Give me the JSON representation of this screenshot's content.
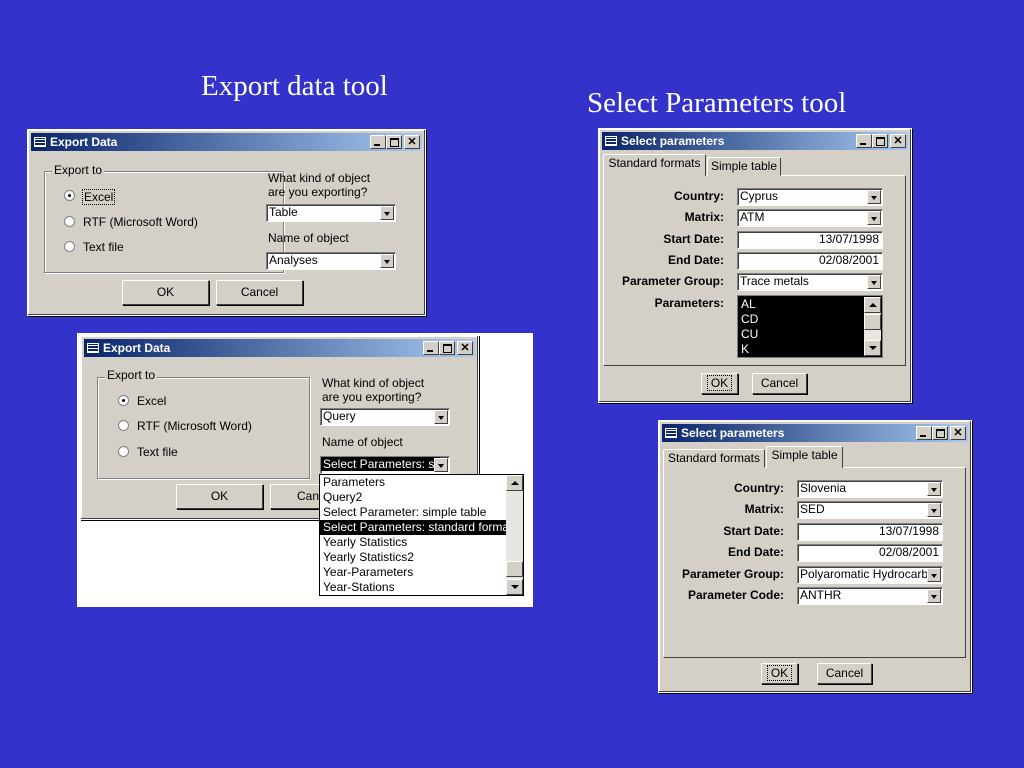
{
  "headings": {
    "export_tool": "Export data tool",
    "select_tool": "Select Parameters tool"
  },
  "export1": {
    "title": "Export Data",
    "group_label": "Export to",
    "options": [
      "Excel",
      "RTF (Microsoft Word)",
      "Text file"
    ],
    "selected_option": "Excel",
    "kind_label_1": "What kind of object",
    "kind_label_2": "are you exporting?",
    "kind_value": "Table",
    "name_label": "Name of object",
    "name_value": "Analyses",
    "ok": "OK",
    "cancel": "Cancel"
  },
  "export2": {
    "title": "Export Data",
    "group_label": "Export to",
    "options": [
      "Excel",
      "RTF (Microsoft Word)",
      "Text file"
    ],
    "selected_option": "Excel",
    "kind_label_1": "What kind of object",
    "kind_label_2": "are you exporting?",
    "kind_value": "Query",
    "name_label": "Name of object",
    "name_value": "Select Parameters: st",
    "ok": "OK",
    "cancel": "Canc",
    "dropdown_items": [
      "Parameters",
      "Query2",
      "Select Parameter: simple table",
      "Select Parameters: standard formats",
      "Yearly Statistics",
      "Yearly Statistics2",
      "Year-Parameters",
      "Year-Stations"
    ],
    "dropdown_selected": "Select Parameters: standard formats"
  },
  "select1": {
    "title": "Select parameters",
    "tabs": [
      "Standard formats",
      "Simple table"
    ],
    "active_tab": "Standard formats",
    "labels": {
      "country": "Country:",
      "matrix": "Matrix:",
      "start": "Start Date:",
      "end": "End Date:",
      "group": "Parameter Group:",
      "params": "Parameters:"
    },
    "values": {
      "country": "Cyprus",
      "matrix": "ATM",
      "start": "13/07/1998",
      "end": "02/08/2001",
      "group": "Trace metals"
    },
    "parameters_list": [
      "AL",
      "CD",
      "CU",
      "K"
    ],
    "ok": "OK",
    "cancel": "Cancel"
  },
  "select2": {
    "title": "Select parameters",
    "tabs": [
      "Standard formats",
      "Simple table"
    ],
    "active_tab": "Simple table",
    "labels": {
      "country": "Country:",
      "matrix": "Matrix:",
      "start": "Start Date:",
      "end": "End Date:",
      "group": "Parameter Group:",
      "code": "Parameter Code:"
    },
    "values": {
      "country": "Slovenia",
      "matrix": "SED",
      "start": "13/07/1998",
      "end": "02/08/2001",
      "group": "Polyaromatic Hydrocarbo",
      "code": "ANTHR"
    },
    "ok": "OK",
    "cancel": "Cancel"
  }
}
